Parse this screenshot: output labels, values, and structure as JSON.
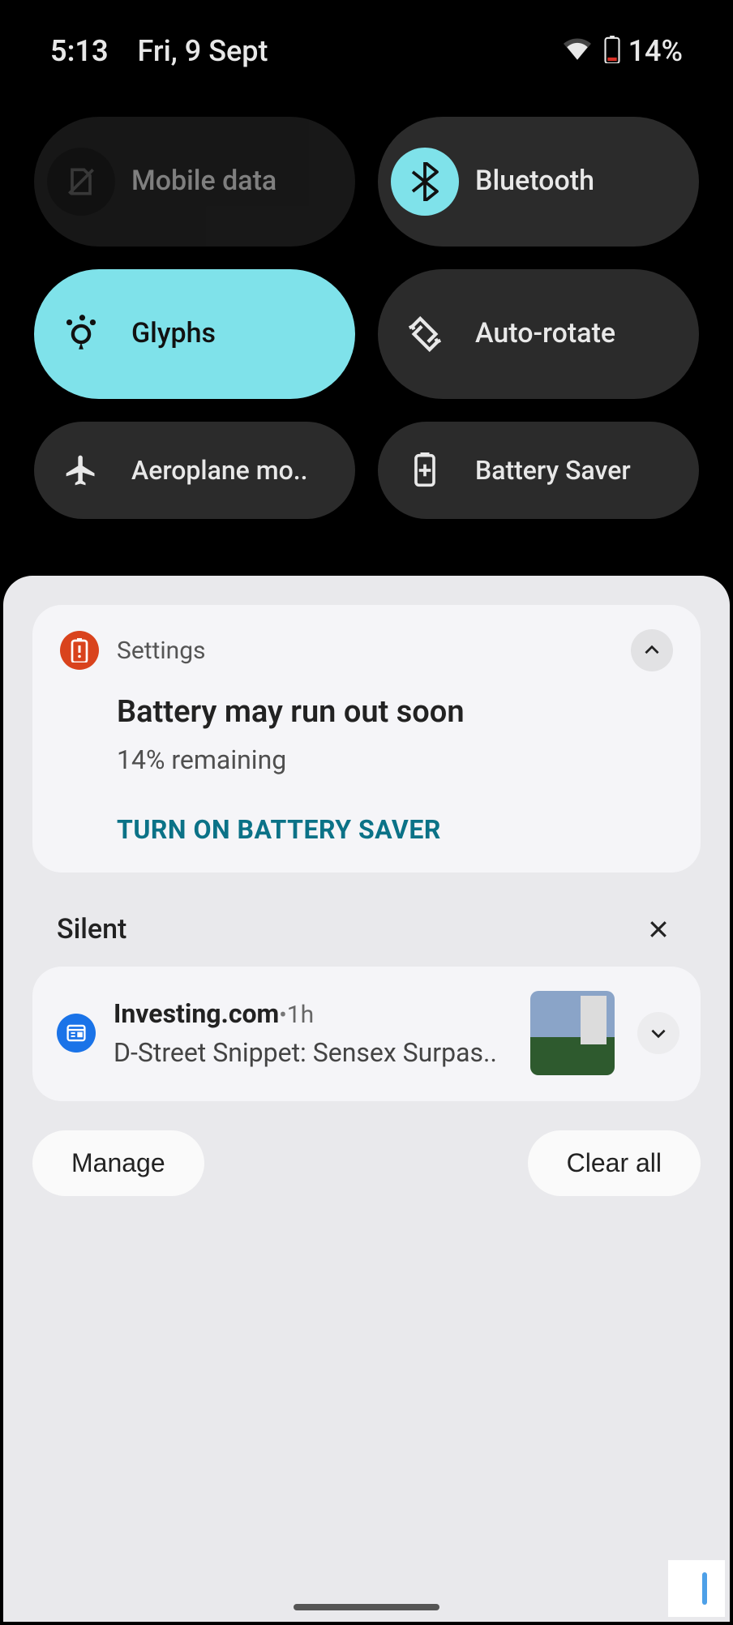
{
  "status": {
    "time": "5:13",
    "date": "Fri, 9 Sept",
    "battery_pct": "14%"
  },
  "qs": {
    "tiles": [
      {
        "label": "Mobile data",
        "icon": "sim-off-icon",
        "state": "disabled"
      },
      {
        "label": "Bluetooth",
        "icon": "bluetooth-icon",
        "state": "icon-active"
      },
      {
        "label": "Glyphs",
        "icon": "glyphs-icon",
        "state": "active"
      },
      {
        "label": "Auto-rotate",
        "icon": "auto-rotate-icon",
        "state": "off"
      },
      {
        "label": "Aeroplane mo..",
        "icon": "airplane-icon",
        "state": "off"
      },
      {
        "label": "Battery Saver",
        "icon": "battery-saver-icon",
        "state": "off"
      }
    ]
  },
  "notifications": {
    "settings": {
      "app": "Settings",
      "title": "Battery may run out soon",
      "subtitle": "14% remaining",
      "action": "TURN ON BATTERY SAVER"
    },
    "silent_label": "Silent",
    "silent_item": {
      "app": "Investing.com",
      "sep": " • ",
      "time": "1h",
      "body": "D-Street Snippet: Sensex Surpas.."
    },
    "manage": "Manage",
    "clear_all": "Clear all"
  }
}
